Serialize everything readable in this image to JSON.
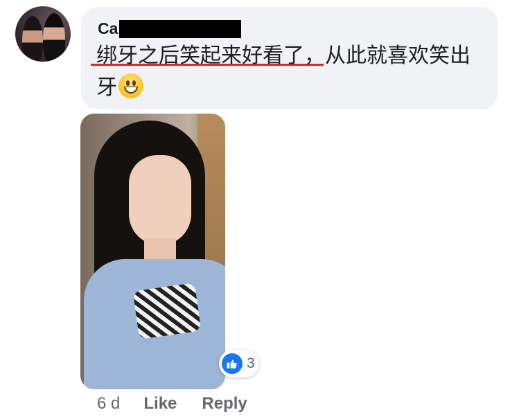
{
  "comment": {
    "author_visible": "Ca",
    "text_underlined": "绑牙之后笑起来好看了",
    "text_rest": "，从此就喜欢笑出牙",
    "emoji": "grinning-face-emoji"
  },
  "reactions": {
    "type": "like",
    "count": "3"
  },
  "actions": {
    "time": "6 d",
    "like": "Like",
    "reply": "Reply"
  },
  "colors": {
    "bubble": "#f0f2f5",
    "like_blue": "#1877f2",
    "underline": "#e0262c",
    "muted": "#65676b"
  }
}
